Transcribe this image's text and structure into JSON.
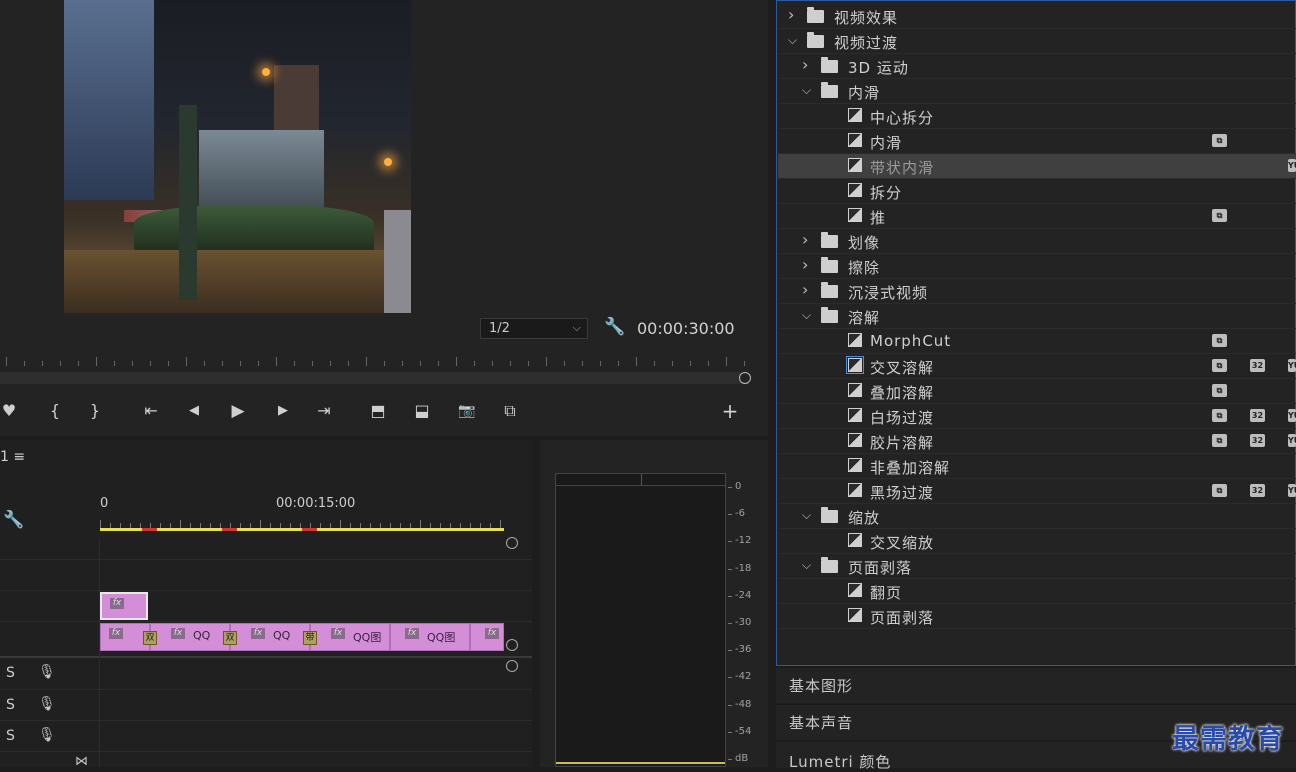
{
  "monitor": {
    "resolution": "1/2",
    "timecode": "00:00:30:00",
    "transport": {
      "marker": "♥",
      "in": "{",
      "out": "}",
      "go_in": "⇤",
      "step_back": "◀",
      "play": "▶",
      "step_fwd": "▶",
      "go_out": "⇥",
      "lift": "⬒",
      "extract": "⬓",
      "export_frame": "📷",
      "compare": "⧉",
      "add": "+"
    }
  },
  "timeline": {
    "sequence_label": "1 ≡",
    "ruler_start": "0",
    "ruler_mark": "00:00:15:00",
    "clip_labels": [
      "fx",
      "QQ",
      "QQ图"
    ],
    "transition_labels": [
      "双",
      "双",
      "带"
    ],
    "audio_tracks": [
      {
        "solo": "S"
      },
      {
        "solo": "S"
      },
      {
        "solo": "S"
      }
    ]
  },
  "meter": {
    "db_labels": [
      "0",
      "-6",
      "-12",
      "-18",
      "-24",
      "-30",
      "-36",
      "-42",
      "-48",
      "-54",
      "dB"
    ]
  },
  "effects": {
    "rows": [
      {
        "label": "视频效果",
        "type": "folder",
        "expanded": false,
        "level": 0
      },
      {
        "label": "视频过渡",
        "type": "folder",
        "expanded": true,
        "level": 0
      },
      {
        "label": "3D 运动",
        "type": "folder",
        "expanded": false,
        "level": 1
      },
      {
        "label": "内滑",
        "type": "folder",
        "expanded": true,
        "level": 1
      },
      {
        "label": "中心拆分",
        "type": "effect",
        "level": 2,
        "badges": []
      },
      {
        "label": "内滑",
        "type": "effect",
        "level": 2,
        "badges": [
          "accel"
        ]
      },
      {
        "label": "带状内滑",
        "type": "effect",
        "level": 2,
        "badges": [
          "yuv"
        ],
        "selected": true
      },
      {
        "label": "拆分",
        "type": "effect",
        "level": 2,
        "badges": []
      },
      {
        "label": "推",
        "type": "effect",
        "level": 2,
        "badges": [
          "accel"
        ]
      },
      {
        "label": "划像",
        "type": "folder",
        "expanded": false,
        "level": 1
      },
      {
        "label": "擦除",
        "type": "folder",
        "expanded": false,
        "level": 1
      },
      {
        "label": "沉浸式视频",
        "type": "folder",
        "expanded": false,
        "level": 1
      },
      {
        "label": "溶解",
        "type": "folder",
        "expanded": true,
        "level": 1
      },
      {
        "label": "MorphCut",
        "type": "effect",
        "level": 2,
        "badges": [
          "accel"
        ]
      },
      {
        "label": "交叉溶解",
        "type": "effect",
        "level": 2,
        "badges": [
          "accel",
          "32",
          "yuv"
        ],
        "focused": true
      },
      {
        "label": "叠加溶解",
        "type": "effect",
        "level": 2,
        "badges": [
          "accel"
        ]
      },
      {
        "label": "白场过渡",
        "type": "effect",
        "level": 2,
        "badges": [
          "accel",
          "32",
          "yuv"
        ]
      },
      {
        "label": "胶片溶解",
        "type": "effect",
        "level": 2,
        "badges": [
          "accel",
          "32",
          "yuv"
        ]
      },
      {
        "label": "非叠加溶解",
        "type": "effect",
        "level": 2,
        "badges": []
      },
      {
        "label": "黑场过渡",
        "type": "effect",
        "level": 2,
        "badges": [
          "accel",
          "32",
          "yuv"
        ]
      },
      {
        "label": "缩放",
        "type": "folder",
        "expanded": true,
        "level": 1
      },
      {
        "label": "交叉缩放",
        "type": "effect",
        "level": 2,
        "badges": []
      },
      {
        "label": "页面剥落",
        "type": "folder",
        "expanded": true,
        "level": 1
      },
      {
        "label": "翻页",
        "type": "effect",
        "level": 2,
        "badges": []
      },
      {
        "label": "页面剥落",
        "type": "effect",
        "level": 2,
        "badges": []
      }
    ],
    "badge_text": {
      "accel": "⧉",
      "32": "32",
      "yuv": "YU"
    }
  },
  "panels": [
    {
      "label": "基本图形"
    },
    {
      "label": "基本声音"
    },
    {
      "label": "Lumetri 颜色"
    }
  ],
  "watermark": "最需教育",
  "colors": {
    "accent_border": "#2f5b9a",
    "clip_pink": "#d48ed8",
    "work_area": "#e8e05a"
  }
}
